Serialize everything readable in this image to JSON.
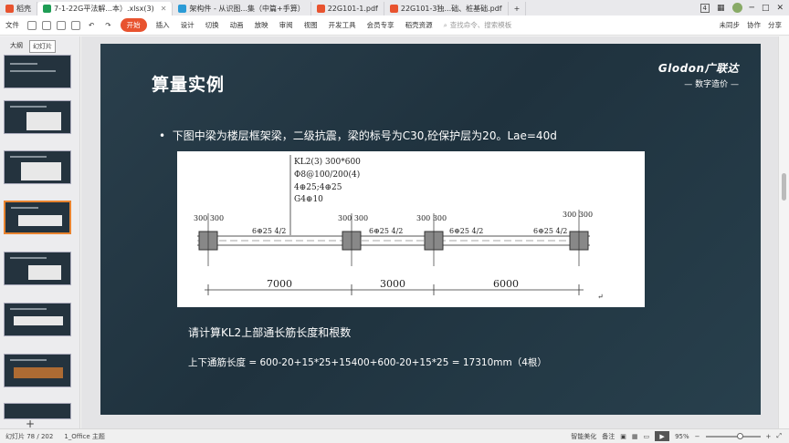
{
  "tabs": [
    {
      "label": "稻壳",
      "color": "#e8532f"
    },
    {
      "label": "7-1-22G平法解...本）.xlsx(3)",
      "color": "#1f9d55",
      "active": true
    },
    {
      "label": "架构件 - 从识图...集（中篇+手算）",
      "color": "#2b9bd6"
    },
    {
      "label": "22G101-1.pdf",
      "color": "#e8532f"
    },
    {
      "label": "22G101-3独...础、桩基础.pdf",
      "color": "#e8532f"
    }
  ],
  "titlebar_right": {
    "badge": "4"
  },
  "menu": {
    "file": "文件",
    "start": "开始",
    "items": [
      "插入",
      "设计",
      "切换",
      "动画",
      "放映",
      "审阅",
      "视图",
      "开发工具",
      "会员专享",
      "稻壳资源"
    ],
    "search": "查找命令、搜索模板",
    "right": [
      "未同步",
      "协作",
      "分享"
    ]
  },
  "sidebar": {
    "tab1": "大纲",
    "tab2": "幻灯片",
    "add": "+"
  },
  "slide": {
    "title": "算量实例",
    "logo_line1": "Glodon广联达",
    "logo_line2": "— 数字造价 —",
    "bullet": "下图中梁为楼层框架梁，二级抗震，梁的标号为C30,砼保护层为20。Lae=40d",
    "question": "请计算KL2上部通长筋长度和根数",
    "answer": "上下通筋长度 = 600-20+15*25+15400+600-20+15*25 = 17310mm（4根）"
  },
  "drawing": {
    "anno": [
      "KL2(3) 300*600",
      "Φ8@100/200(4)",
      "4⊕25;4⊕25",
      "G4⊕10"
    ],
    "col_pair": "300 300",
    "rebar": "6⊕25 4/2",
    "spans": [
      "7000",
      "3000",
      "6000"
    ]
  },
  "status": {
    "page": "幻灯片 78 / 202",
    "theme": "1_Office 主题",
    "beautify": "智能美化",
    "notes": "备注",
    "zoom": "95%"
  }
}
